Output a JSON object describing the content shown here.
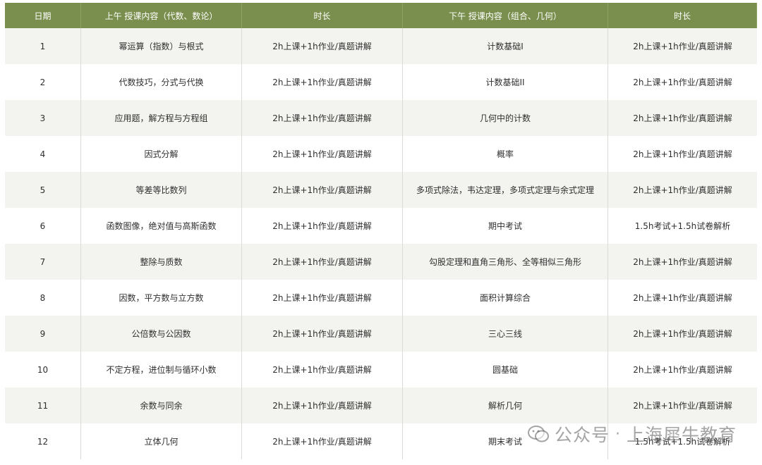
{
  "table": {
    "headers": [
      "日期",
      "上午 授课内容（代数、数论）",
      "时长",
      "下午 授课内容（组合、几何）",
      "时长"
    ],
    "rows": [
      [
        "1",
        "幂运算（指数）与根式",
        "2h上课+1h作业/真题讲解",
        "计数基础I",
        "2h上课+1h作业/真题讲解"
      ],
      [
        "2",
        "代数技巧，分式与代换",
        "2h上课+1h作业/真题讲解",
        "计数基础II",
        "2h上课+1h作业/真题讲解"
      ],
      [
        "3",
        "应用题，解方程与方程组",
        "2h上课+1h作业/真题讲解",
        "几何中的计数",
        "2h上课+1h作业/真题讲解"
      ],
      [
        "4",
        "因式分解",
        "2h上课+1h作业/真题讲解",
        "概率",
        "2h上课+1h作业/真题讲解"
      ],
      [
        "5",
        "等差等比数列",
        "2h上课+1h作业/真题讲解",
        "多项式除法，韦达定理，多项式定理与余式定理",
        "2h上课+1h作业/真题讲解"
      ],
      [
        "6",
        "函数图像，绝对值与高斯函数",
        "2h上课+1h作业/真题讲解",
        "期中考试",
        "1.5h考试+1.5h试卷解析"
      ],
      [
        "7",
        "整除与质数",
        "2h上课+1h作业/真题讲解",
        "勾股定理和直角三角形、全等相似三角形",
        "2h上课+1h作业/真题讲解"
      ],
      [
        "8",
        "因数，平方数与立方数",
        "2h上课+1h作业/真题讲解",
        "面积计算综合",
        "2h上课+1h作业/真题讲解"
      ],
      [
        "9",
        "公倍数与公因数",
        "2h上课+1h作业/真题讲解",
        "三心三线",
        "2h上课+1h作业/真题讲解"
      ],
      [
        "10",
        "不定方程，进位制与循环小数",
        "2h上课+1h作业/真题讲解",
        "圆基础",
        "2h上课+1h作业/真题讲解"
      ],
      [
        "11",
        "余数与同余",
        "2h上课+1h作业/真题讲解",
        "解析几何",
        "2h上课+1h作业/真题讲解"
      ],
      [
        "12",
        "立体几何",
        "2h上课+1h作业/真题讲解",
        "期末考试",
        "1.5h考试+1.5h试卷解析"
      ]
    ]
  },
  "watermark": {
    "icon": "wechat-icon",
    "text": "公众号",
    "separator": "·",
    "account": "上海犀牛教育"
  },
  "colors": {
    "header_bg": "#7a8f4d",
    "header_text": "#ffffff",
    "row_alt_bg": "#f3f3ef"
  }
}
